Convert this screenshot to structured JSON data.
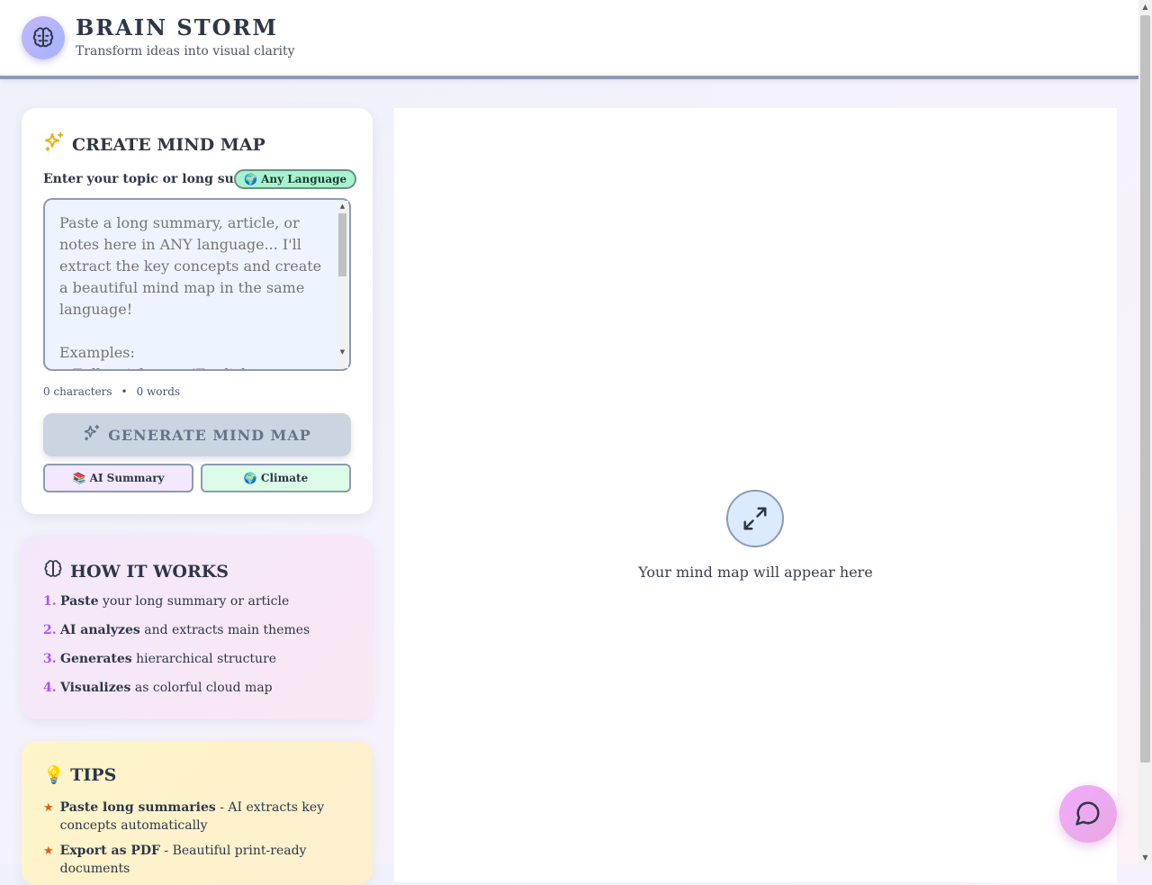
{
  "header": {
    "title": "BRAIN STORM",
    "subtitle": "Transform ideas into visual clarity",
    "logo_icon": "brain-icon"
  },
  "create": {
    "title": "CREATE MIND MAP",
    "title_icon": "sparkles-icon",
    "input_label": "Enter your topic or long summary",
    "language_badge": "🌍 Any Language",
    "textarea_placeholder": "Paste a long summary, article, or notes here in ANY language... I'll extract the key concepts and create a beautiful mind map in the same language!\n\nExamples:\n• Full article text (English, Afrikaans, Spanish, etc.)",
    "char_count": "0 characters",
    "separator": "•",
    "word_count": "0 words",
    "generate_label": "GENERATE MIND MAP",
    "chips": {
      "ai_summary": "📚 AI Summary",
      "climate": "🌍 Climate"
    }
  },
  "how": {
    "title": "HOW IT WORKS",
    "steps": [
      {
        "num": "1.",
        "bold": "Paste",
        "rest": "your long summary or article"
      },
      {
        "num": "2.",
        "bold": "AI analyzes",
        "rest": "and extracts main themes"
      },
      {
        "num": "3.",
        "bold": "Generates",
        "rest": "hierarchical structure"
      },
      {
        "num": "4.",
        "bold": "Visualizes",
        "rest": "as colorful cloud map"
      }
    ]
  },
  "tips": {
    "title": "💡 TIPS",
    "items": [
      {
        "bold": "Paste long summaries",
        "rest": " - AI extracts key concepts automatically"
      },
      {
        "bold": "Export as PDF",
        "rest": " - Beautiful print-ready documents"
      }
    ]
  },
  "canvas": {
    "placeholder": "Your mind map will appear here",
    "icon": "expand-arrows-icon"
  },
  "chat": {
    "icon": "chat-bubble-icon"
  }
}
